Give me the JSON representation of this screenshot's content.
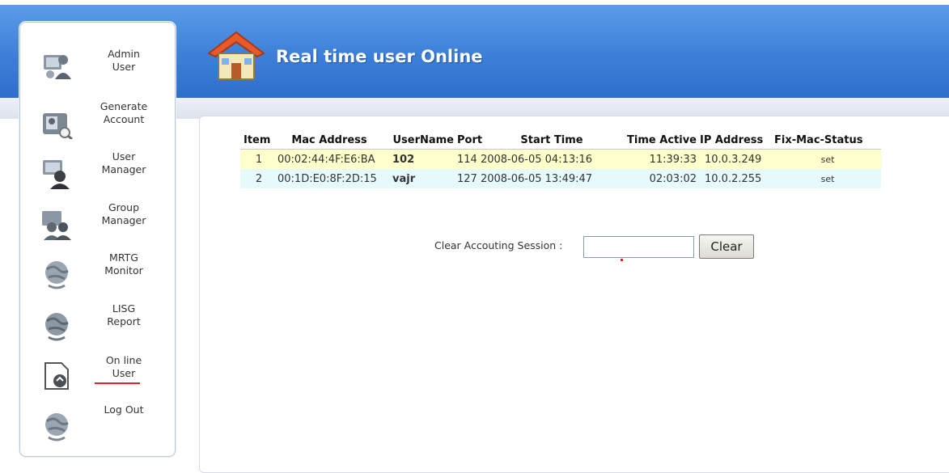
{
  "header": {
    "title": "Real time user Online"
  },
  "sidebar": {
    "items": [
      {
        "label1": "Admin",
        "label2": "User"
      },
      {
        "label1": "Generate",
        "label2": "Account"
      },
      {
        "label1": "User",
        "label2": "Manager"
      },
      {
        "label1": "Group",
        "label2": "Manager"
      },
      {
        "label1": "MRTG",
        "label2": "Monitor"
      },
      {
        "label1": "LISG",
        "label2": "Report"
      },
      {
        "label1": "On line",
        "label2": "User"
      },
      {
        "label1": "Log Out",
        "label2": ""
      }
    ],
    "active_index": 6
  },
  "table": {
    "headers": [
      "Item",
      "Mac Address",
      "UserName",
      "Port",
      "Start Time",
      "Time Active",
      "IP Address",
      "Fix-Mac-Status"
    ],
    "rows": [
      {
        "item": "1",
        "mac": "00:02:44:4F:E6:BA",
        "user": "102",
        "port": "114",
        "start": "2008-06-05 04:13:16",
        "active": "11:39:33",
        "ip": "10.0.3.249",
        "status": "set"
      },
      {
        "item": "2",
        "mac": "00:1D:E0:8F:2D:15",
        "user": "vajr",
        "port": "127",
        "start": "2008-06-05 13:49:47",
        "active": "02:03:02",
        "ip": "10.0.2.255",
        "status": "set"
      }
    ]
  },
  "clear": {
    "label": "Clear Accouting Session :",
    "value": "",
    "button": "Clear"
  },
  "colors": {
    "header_blue": "#3c7fd8",
    "row1": "#ffffcc",
    "row2": "#e6fafc",
    "time_red": "#e0102a",
    "active_underline": "#e0202a"
  }
}
